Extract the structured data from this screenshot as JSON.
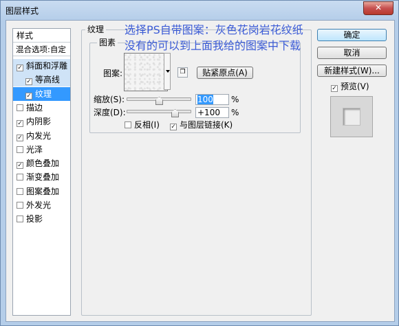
{
  "window": {
    "title": "图层样式",
    "close_glyph": "✕"
  },
  "left_panel": {
    "header": "样式",
    "blend_options": "混合选项:自定",
    "items": [
      {
        "label": "斜面和浮雕",
        "checked": true,
        "state": "sel-light",
        "sub": false
      },
      {
        "label": "等高线",
        "checked": true,
        "state": "sel-light",
        "sub": true
      },
      {
        "label": "纹理",
        "checked": true,
        "state": "sel",
        "sub": true
      },
      {
        "label": "描边",
        "checked": false,
        "state": "",
        "sub": false
      },
      {
        "label": "内阴影",
        "checked": true,
        "state": "",
        "sub": false
      },
      {
        "label": "内发光",
        "checked": true,
        "state": "",
        "sub": false
      },
      {
        "label": "光泽",
        "checked": false,
        "state": "",
        "sub": false
      },
      {
        "label": "颜色叠加",
        "checked": true,
        "state": "",
        "sub": false
      },
      {
        "label": "渐变叠加",
        "checked": false,
        "state": "",
        "sub": false
      },
      {
        "label": "图案叠加",
        "checked": false,
        "state": "",
        "sub": false
      },
      {
        "label": "外发光",
        "checked": false,
        "state": "",
        "sub": false
      },
      {
        "label": "投影",
        "checked": false,
        "state": "",
        "sub": false
      }
    ]
  },
  "texture": {
    "group_title": "纹理",
    "subgroup_title": "图素",
    "pattern_label": "图案:",
    "snap_origin_button": "贴紧原点(A)",
    "scale_label": "缩放(S):",
    "scale_value": "100",
    "scale_unit": "%",
    "depth_label": "深度(D):",
    "depth_value": "+100",
    "depth_unit": "%",
    "invert_label": "反相(I)",
    "invert_checked": false,
    "link_label": "与图层链接(K)",
    "link_checked": true
  },
  "buttons": {
    "ok": "确定",
    "cancel": "取消",
    "new_style": "新建样式(W)...",
    "preview_label": "预览(V)",
    "preview_checked": true
  },
  "annotation": {
    "line1": "选择PS自带图案：灰色花岗岩花纹纸",
    "line2": "没有的可以到上面我给的图案中下载"
  }
}
